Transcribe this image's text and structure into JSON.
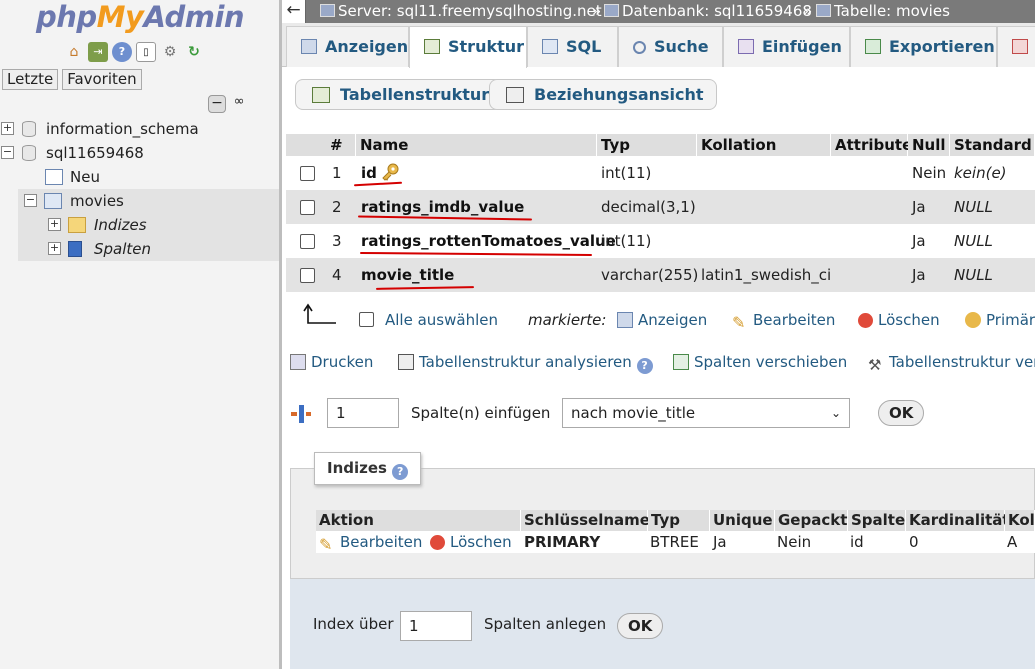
{
  "nav": {
    "logo": {
      "php": "php",
      "my": "My",
      "admin": "Admin"
    },
    "tabs": [
      "Letzte",
      "Favoriten"
    ],
    "tree": [
      {
        "label": "information_schema",
        "expander": "+"
      },
      {
        "label": "sql11659468",
        "expander": "−"
      },
      {
        "label": "Neu"
      },
      {
        "label": "movies",
        "expander": "−"
      },
      {
        "label": "Indizes",
        "expander": "+"
      },
      {
        "label": "Spalten",
        "expander": "+"
      }
    ]
  },
  "breadcrumb": {
    "server": "Server: sql11.freemysqlhosting.net",
    "database": "Datenbank: sql11659468",
    "table": "Tabelle: movies",
    "separator": "»"
  },
  "tabs": [
    "Anzeigen",
    "Struktur",
    "SQL",
    "Suche",
    "Einfügen",
    "Exportieren"
  ],
  "subtabs": [
    "Tabellenstruktur",
    "Beziehungsansicht"
  ],
  "structure": {
    "headers": [
      "#",
      "Name",
      "Typ",
      "Kollation",
      "Attribute",
      "Null",
      "Standard"
    ],
    "rows": [
      {
        "num": "1",
        "name": "id",
        "type": "int(11)",
        "collation": "",
        "null": "Nein",
        "default": "kein(e)"
      },
      {
        "num": "2",
        "name": "ratings_imdb_value",
        "type": "decimal(3,1)",
        "collation": "",
        "null": "Ja",
        "default": "NULL"
      },
      {
        "num": "3",
        "name": "ratings_rottenTomatoes_value",
        "type": "int(11)",
        "collation": "",
        "null": "Ja",
        "default": "NULL"
      },
      {
        "num": "4",
        "name": "movie_title",
        "type": "varchar(255)",
        "collation": "latin1_swedish_ci",
        "null": "Ja",
        "default": "NULL"
      }
    ]
  },
  "bulk": {
    "select_all": "Alle auswählen",
    "marked": "markierte:",
    "actions": [
      "Anzeigen",
      "Bearbeiten",
      "Löschen",
      "Primär"
    ]
  },
  "tools": [
    "Drucken",
    "Tabellenstruktur analysieren",
    "Spalten verschieben",
    "Tabellenstruktur verb"
  ],
  "insert": {
    "count": "1",
    "label": "Spalte(n) einfügen",
    "position": "nach movie_title",
    "ok": "OK"
  },
  "indexes": {
    "legend": "Indizes",
    "headers": [
      "Aktion",
      "Schlüsselname",
      "Typ",
      "Unique",
      "Gepackt",
      "Spalte",
      "Kardinalität",
      "Koll"
    ],
    "row": {
      "edit": "Bearbeiten",
      "delete": "Löschen",
      "keyname": "PRIMARY",
      "type": "BTREE",
      "unique": "Ja",
      "packed": "Nein",
      "column": "id",
      "cardinality": "0",
      "collation": "A"
    },
    "create": {
      "prefix": "Index über",
      "count": "1",
      "suffix": "Spalten anlegen",
      "ok": "OK"
    }
  },
  "colors": {
    "link": "#235a81",
    "annotation": "#d40000",
    "topbar": "#7a7a7a"
  }
}
